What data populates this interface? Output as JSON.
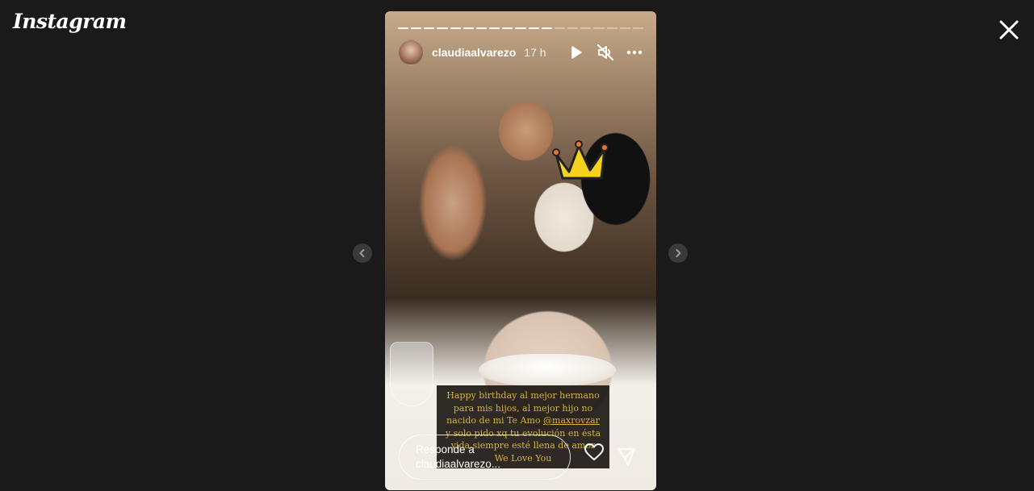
{
  "app": {
    "logo_text": "Instagram"
  },
  "story": {
    "segments_total": 19,
    "segments_done": 12,
    "username": "claudiaalvarezo",
    "time": "17 h",
    "caption": {
      "line1": "Happy birthday al mejor hermano",
      "line2": "para mis hijos, al mejor hijo no",
      "line3_pre": "nacido de mi Te Amo ",
      "mention": "@maxrovzar",
      "line4": "y solo pido xq tu evolución en ésta",
      "line5": "vida siempre esté llena de amor",
      "line6": "We Love You"
    },
    "reply_placeholder_line1": "Responde a",
    "reply_placeholder_line2": "claudiaalvarezo..."
  },
  "icons": {
    "play": "play-icon",
    "mute": "speaker-muted-icon",
    "more": "more-horizontal-icon",
    "close": "close-icon",
    "prev": "chevron-left-icon",
    "next": "chevron-right-icon",
    "like": "heart-icon",
    "send": "send-icon"
  }
}
